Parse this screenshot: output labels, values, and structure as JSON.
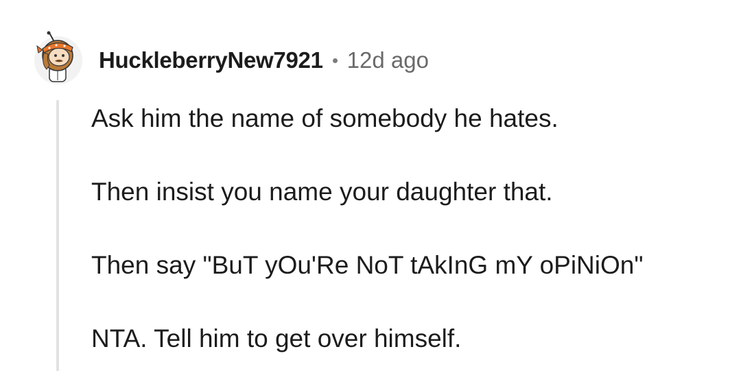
{
  "comment": {
    "author": "HuckleberryNew7921",
    "separator": "•",
    "age": "12d ago",
    "avatar_icon": "snoo-avatar-icon",
    "paragraphs": [
      "Ask him the name of somebody he hates.",
      "Then insist you name your daughter that.",
      "Then say \"BuT yOu'Re NoT tAkInG mY oPiNiOn\"",
      "NTA. Tell him to get over himself."
    ]
  },
  "colors": {
    "text": "#1c1c1c",
    "meta": "#6a6a6a",
    "thread_line": "#e2e2e2",
    "avatar_accent": "#e8762b"
  }
}
